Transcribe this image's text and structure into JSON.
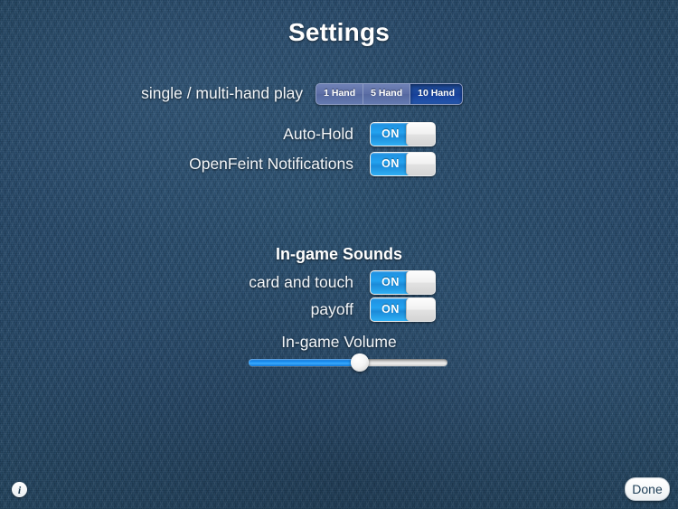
{
  "screen": {
    "title": "Settings",
    "background_color": "#24475f"
  },
  "hand_play": {
    "label": "single / multi-hand play",
    "options": [
      {
        "label": "1 Hand",
        "selected": false
      },
      {
        "label": "5 Hand",
        "selected": false
      },
      {
        "label": "10 Hand",
        "selected": true
      }
    ],
    "selected_value": "10 Hand",
    "selected_color": "#1a459a",
    "unselected_color": "#5c6ea6"
  },
  "general": {
    "rows": [
      {
        "label": "Auto-Hold",
        "state": "ON"
      },
      {
        "label": "OpenFeint Notifications",
        "state": "ON"
      }
    ]
  },
  "sounds": {
    "header": "In-game Sounds",
    "rows": [
      {
        "label": "card and touch",
        "state": "ON"
      },
      {
        "label": "payoff",
        "state": "ON"
      }
    ]
  },
  "volume": {
    "label": "In-game Volume",
    "value_percent": 56,
    "min": 0,
    "max": 100,
    "fill_color": "#1b8ff0"
  },
  "footer": {
    "info_icon": "info-icon",
    "info_glyph": "i",
    "done_label": "Done"
  }
}
